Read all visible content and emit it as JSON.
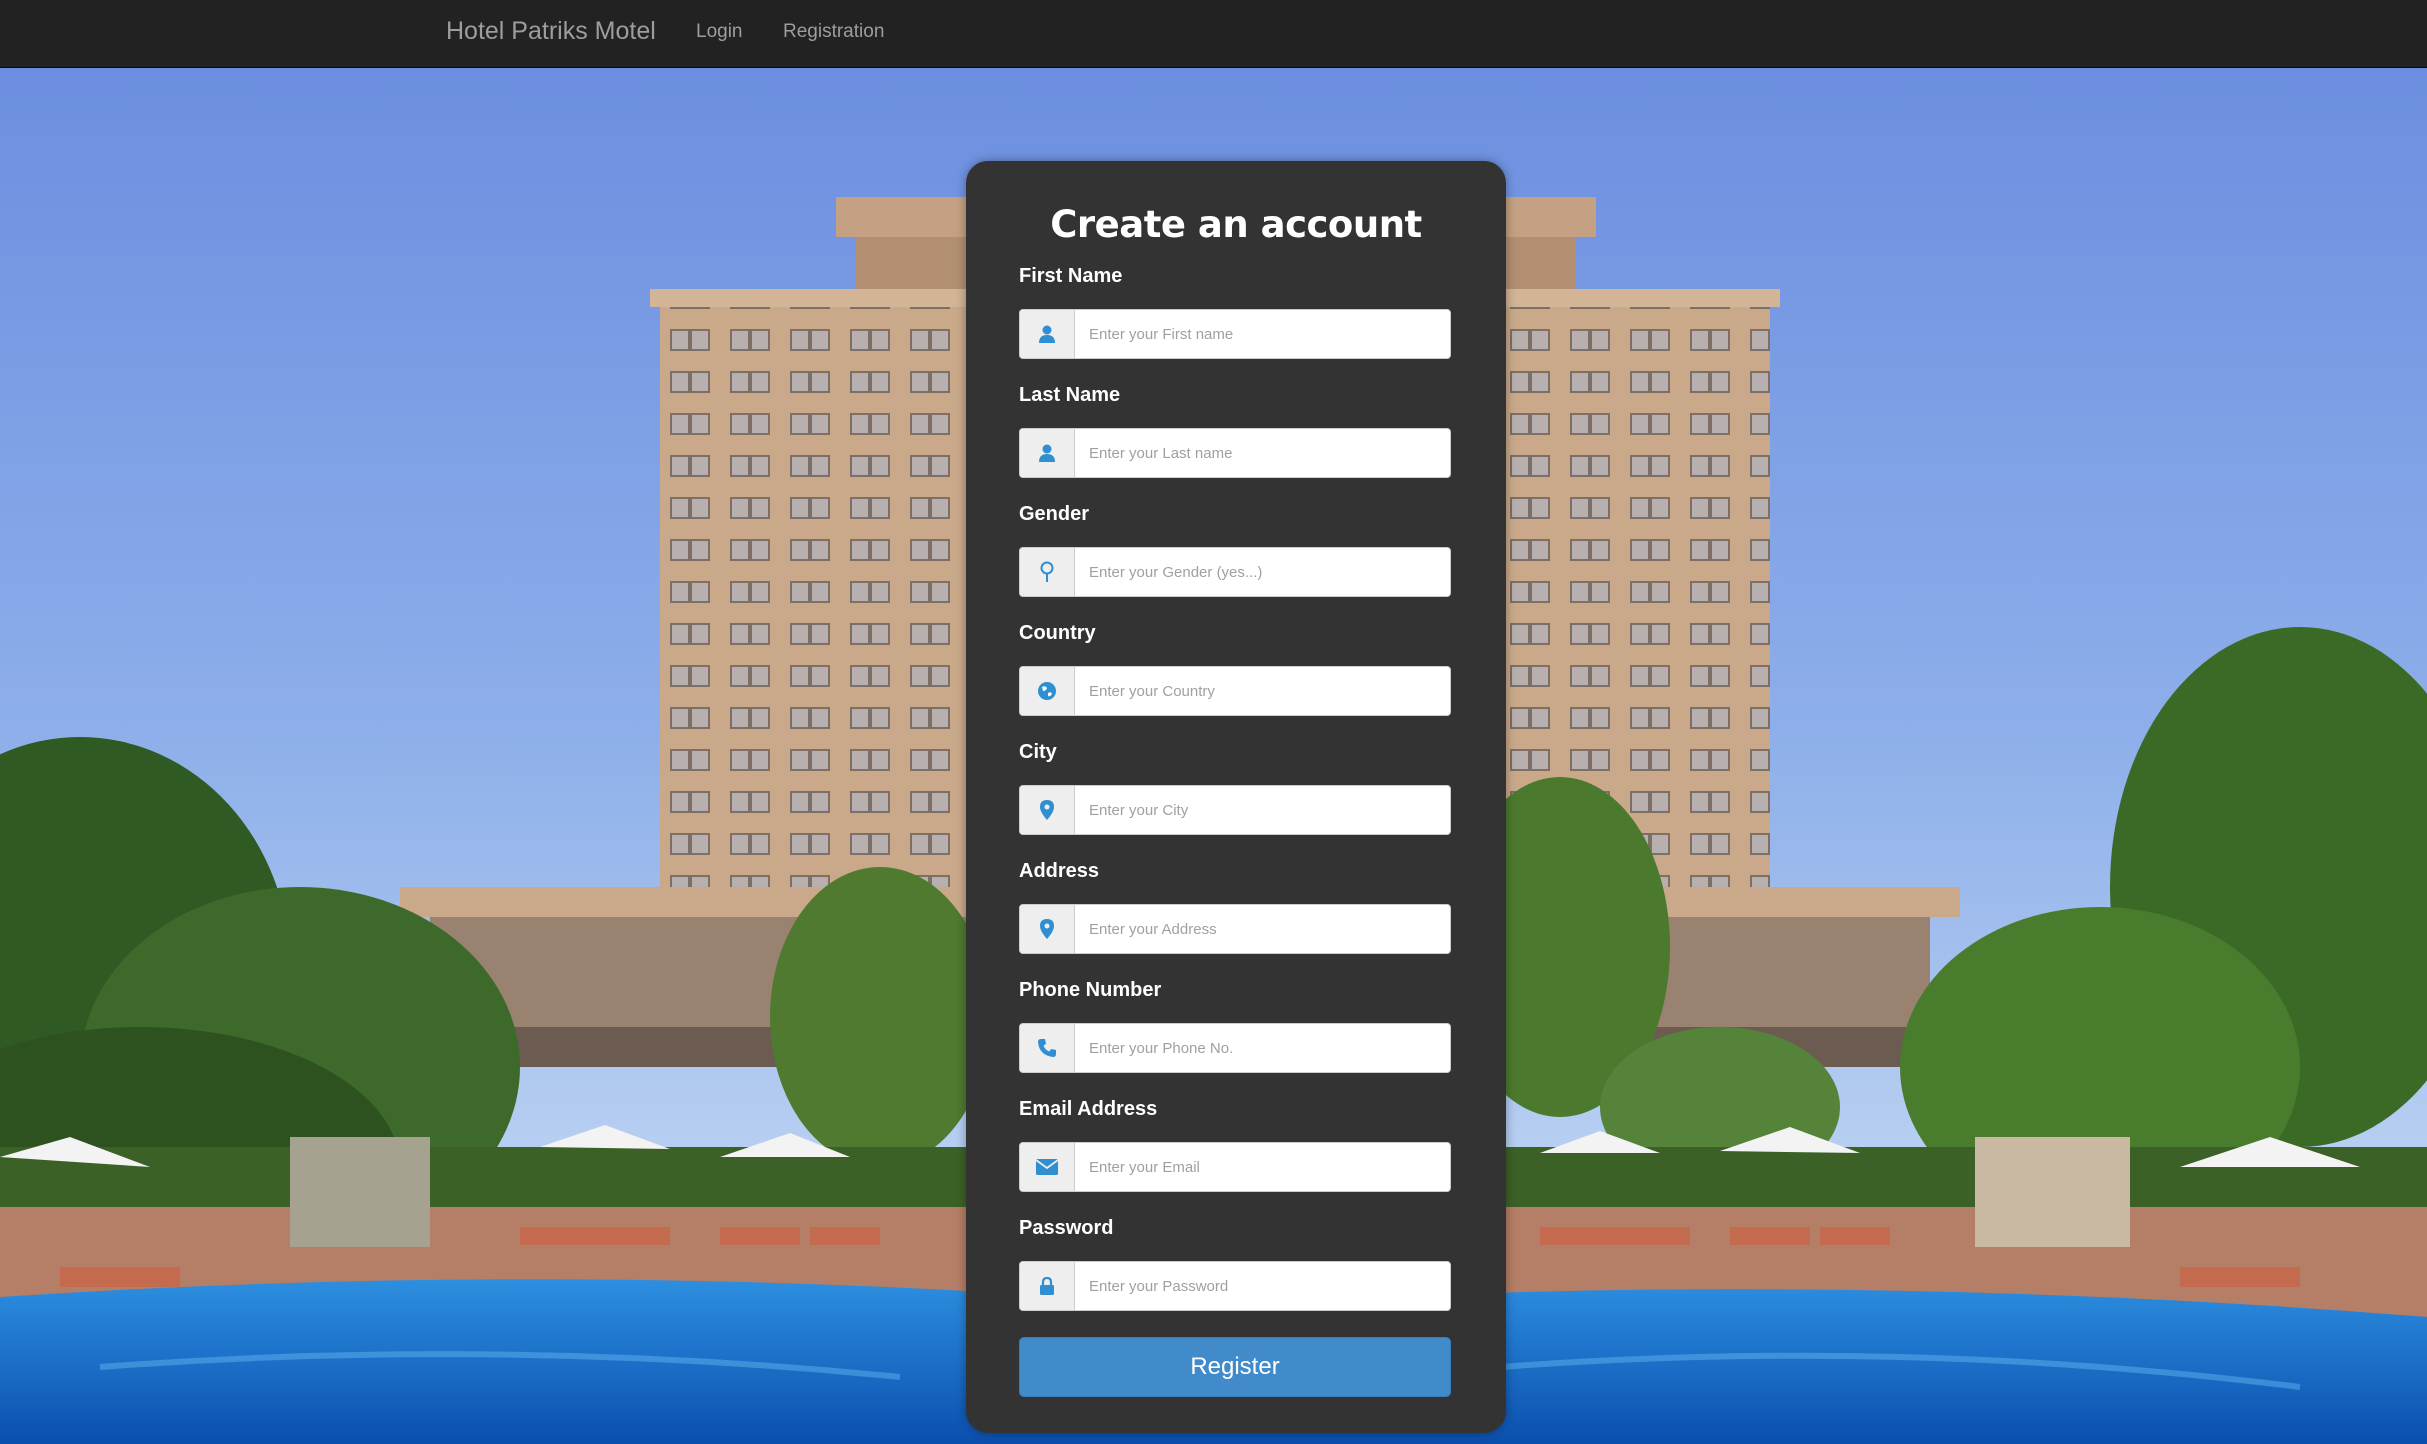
{
  "nav": {
    "brand": "Hotel Patriks Motel",
    "links": [
      "Login",
      "Registration"
    ]
  },
  "form": {
    "title": "Create an account",
    "fields": [
      {
        "label": "First Name",
        "placeholder": "Enter your First name",
        "icon": "user-icon"
      },
      {
        "label": "Last Name",
        "placeholder": "Enter your Last name",
        "icon": "user-icon"
      },
      {
        "label": "Gender",
        "placeholder": "Enter your Gender (yes...)",
        "icon": "gender-pin-icon"
      },
      {
        "label": "Country",
        "placeholder": "Enter your Country",
        "icon": "globe-icon"
      },
      {
        "label": "City",
        "placeholder": "Enter your City",
        "icon": "map-marker-icon"
      },
      {
        "label": "Address",
        "placeholder": "Enter your Address",
        "icon": "map-marker-icon"
      },
      {
        "label": "Phone Number",
        "placeholder": "Enter your Phone No.",
        "icon": "phone-icon"
      },
      {
        "label": "Email Address",
        "placeholder": "Enter your Email",
        "icon": "envelope-icon"
      },
      {
        "label": "Password",
        "placeholder": "Enter your Password",
        "icon": "lock-icon"
      }
    ],
    "submit_label": "Register"
  },
  "colors": {
    "navbar": "#222222",
    "card": "#333333",
    "icon_accent": "#2f8fd0",
    "button": "#428bca"
  }
}
